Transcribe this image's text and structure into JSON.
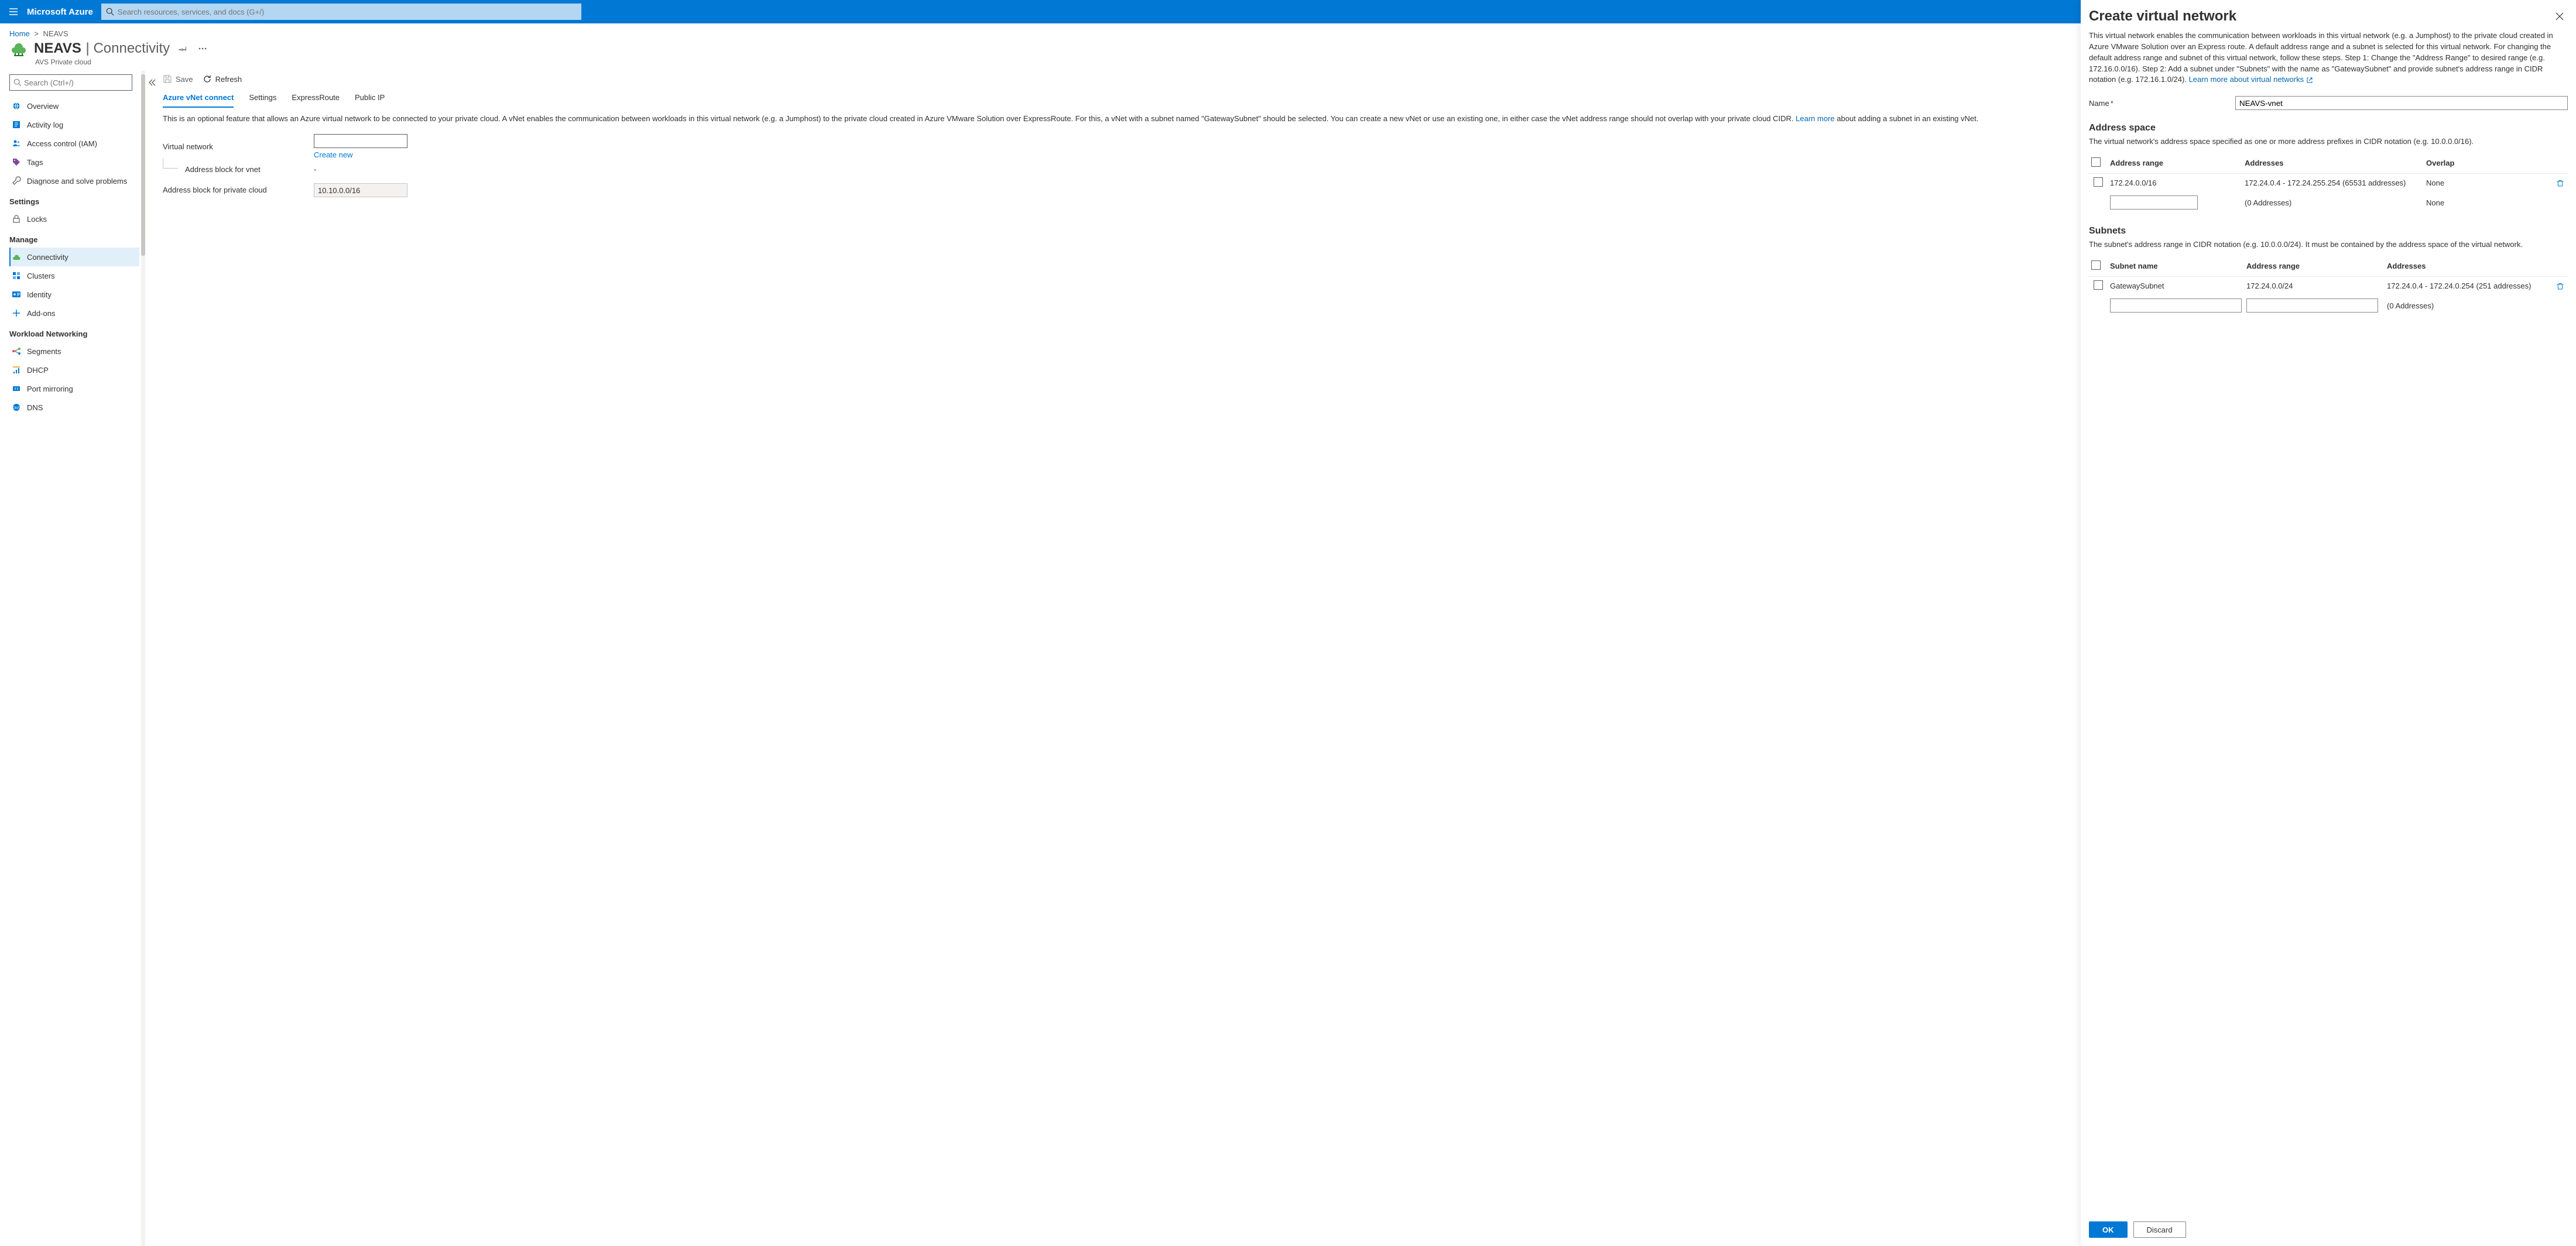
{
  "brand": "Microsoft Azure",
  "search": {
    "placeholder": "Search resources, services, and docs (G+/)"
  },
  "breadcrumb": {
    "home": "Home",
    "current": "NEAVS"
  },
  "page": {
    "title_main": "NEAVS",
    "title_sub": "Connectivity",
    "subtitle": "AVS Private cloud"
  },
  "sidebar": {
    "search_placeholder": "Search (Ctrl+/)",
    "top_items": [
      {
        "label": "Overview",
        "icon": "globe"
      },
      {
        "label": "Activity log",
        "icon": "log"
      },
      {
        "label": "Access control (IAM)",
        "icon": "iam"
      },
      {
        "label": "Tags",
        "icon": "tag"
      },
      {
        "label": "Diagnose and solve problems",
        "icon": "wrench"
      }
    ],
    "sections": [
      {
        "title": "Settings",
        "items": [
          {
            "label": "Locks",
            "icon": "lock"
          }
        ]
      },
      {
        "title": "Manage",
        "items": [
          {
            "label": "Connectivity",
            "icon": "cloud-net",
            "selected": true
          },
          {
            "label": "Clusters",
            "icon": "clusters"
          },
          {
            "label": "Identity",
            "icon": "identity"
          },
          {
            "label": "Add-ons",
            "icon": "plus"
          }
        ]
      },
      {
        "title": "Workload Networking",
        "items": [
          {
            "label": "Segments",
            "icon": "segments"
          },
          {
            "label": "DHCP",
            "icon": "dhcp"
          },
          {
            "label": "Port mirroring",
            "icon": "mirror"
          },
          {
            "label": "DNS",
            "icon": "dns"
          }
        ]
      }
    ]
  },
  "toolbar": {
    "save": "Save",
    "refresh": "Refresh"
  },
  "tabs": [
    {
      "label": "Azure vNet connect",
      "active": true
    },
    {
      "label": "Settings"
    },
    {
      "label": "ExpressRoute"
    },
    {
      "label": "Public IP"
    }
  ],
  "main": {
    "desc_prefix": "This is an optional feature that allows an Azure virtual network to be connected to your private cloud. A vNet enables the communication between workloads in this virtual network (e.g. a Jumphost) to the private cloud created in Azure VMware Solution over ExpressRoute. For this, a vNet with a subnet named \"GatewaySubnet\" should be selected. You can create a new vNet or use an existing one, in either case the vNet address range should not overlap with your private cloud CIDR. ",
    "learn_more": "Learn more",
    "desc_suffix": " about adding a subnet in an existing vNet.",
    "field_vnet": "Virtual network",
    "create_new": "Create new",
    "field_addr_vnet": "Address block for vnet",
    "addr_vnet_value": "-",
    "field_addr_cloud": "Address block for private cloud",
    "addr_cloud_value": "10.10.0.0/16"
  },
  "blade": {
    "title": "Create virtual network",
    "desc": "This virtual network enables the communication between workloads in this virtual network (e.g. a Jumphost) to the private cloud created in Azure VMware Solution over an Express route. A default address range and a subnet is selected for this virtual network. For changing the default address range and subnet of this virtual network, follow these steps. Step 1: Change the \"Address Range\" to desired range (e.g. 172.16.0.0/16). Step 2: Add a subnet under \"Subnets\" with the name as \"GatewaySubnet\" and provide subnet's address range in CIDR notation (e.g. 172.16.1.0/24). ",
    "learn_more": "Learn more about virtual networks",
    "name_label": "Name",
    "name_value": "NEAVS-vnet",
    "addr_space_h": "Address space",
    "addr_space_sub": "The virtual network's address space specified as one or more address prefixes in CIDR notation (e.g. 10.0.0.0/16).",
    "addr_cols": {
      "range": "Address range",
      "addresses": "Addresses",
      "overlap": "Overlap"
    },
    "addr_rows": [
      {
        "range": "172.24.0.0/16",
        "addresses": "172.24.0.4 - 172.24.255.254 (65531 addresses)",
        "overlap": "None",
        "editable": false
      },
      {
        "range": "",
        "addresses": "(0 Addresses)",
        "overlap": "None",
        "editable": true
      }
    ],
    "subnets_h": "Subnets",
    "subnets_sub": "The subnet's address range in CIDR notation (e.g. 10.0.0.0/24). It must be contained by the address space of the virtual network.",
    "sub_cols": {
      "name": "Subnet name",
      "range": "Address range",
      "addresses": "Addresses"
    },
    "sub_rows": [
      {
        "name": "GatewaySubnet",
        "range": "172.24.0.0/24",
        "addresses": "172.24.0.4 - 172.24.0.254 (251 addresses)",
        "editable": false
      },
      {
        "name": "",
        "range": "",
        "addresses": "(0 Addresses)",
        "editable": true
      }
    ],
    "ok": "OK",
    "discard": "Discard"
  }
}
